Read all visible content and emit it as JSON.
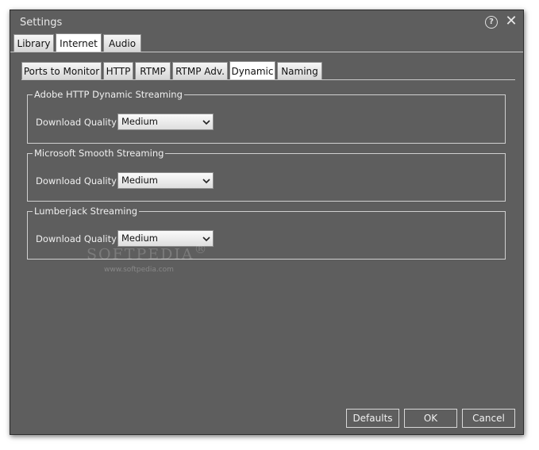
{
  "window": {
    "title": "Settings",
    "help_icon": "question-mark-icon",
    "close_icon": "close-icon",
    "help_glyph": "?",
    "close_glyph": "✕"
  },
  "top_tabs": [
    {
      "label": "Library",
      "active": false
    },
    {
      "label": "Internet",
      "active": true
    },
    {
      "label": "Audio",
      "active": false
    }
  ],
  "inner_tabs": [
    {
      "label": "Ports to Monitor",
      "active": false
    },
    {
      "label": "HTTP",
      "active": false
    },
    {
      "label": "RTMP",
      "active": false
    },
    {
      "label": "RTMP Adv.",
      "active": false
    },
    {
      "label": "Dynamic",
      "active": true
    },
    {
      "label": "Naming",
      "active": false
    }
  ],
  "groups": [
    {
      "title": "Adobe HTTP Dynamic Streaming",
      "field_label": "Download Quality",
      "value": "Medium"
    },
    {
      "title": "Microsoft Smooth Streaming",
      "field_label": "Download Quality",
      "value": "Medium"
    },
    {
      "title": "Lumberjack Streaming",
      "field_label": "Download Quality",
      "value": "Medium"
    }
  ],
  "buttons": {
    "defaults": "Defaults",
    "ok": "OK",
    "cancel": "Cancel"
  },
  "watermark": {
    "text": "SOFTPEDIA",
    "mark": "®",
    "url": "www.softpedia.com"
  },
  "colors": {
    "window_bg": "#5e5e5e",
    "tab_bg": "#e6e6e6",
    "active_tab_bg": "#ffffff",
    "text": "#f0f0f0"
  }
}
